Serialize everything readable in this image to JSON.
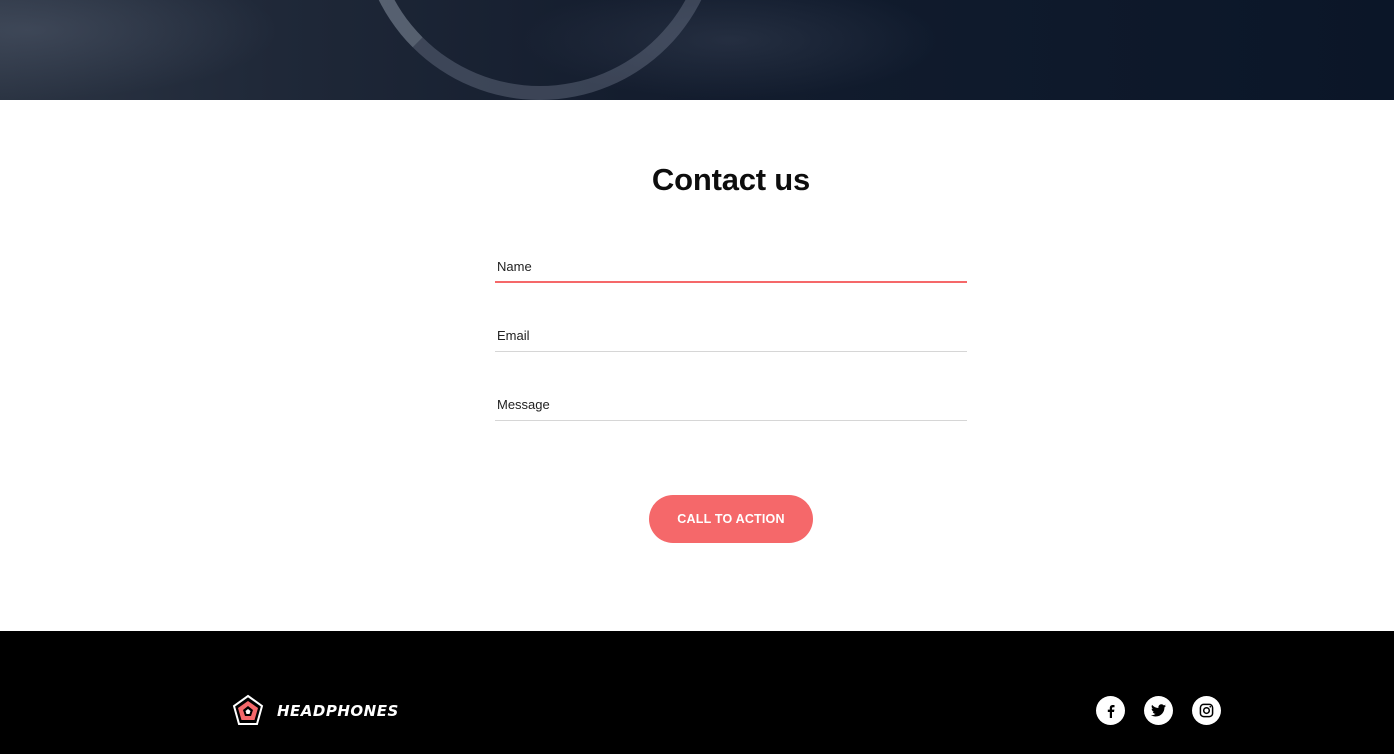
{
  "contact": {
    "title": "Contact us",
    "fields": [
      {
        "label": "Name",
        "state": "active"
      },
      {
        "label": "Email",
        "state": "default"
      },
      {
        "label": "Message",
        "state": "default"
      }
    ],
    "cta_label": "CALL TO ACTION"
  },
  "footer": {
    "brand": "HEADPHONES",
    "socials": [
      {
        "icon": "facebook-icon"
      },
      {
        "icon": "twitter-icon"
      },
      {
        "icon": "instagram-icon"
      }
    ]
  },
  "colors": {
    "accent": "#f5686a",
    "footer_bg": "#000000",
    "hero_bg": "#0f1a2c"
  }
}
